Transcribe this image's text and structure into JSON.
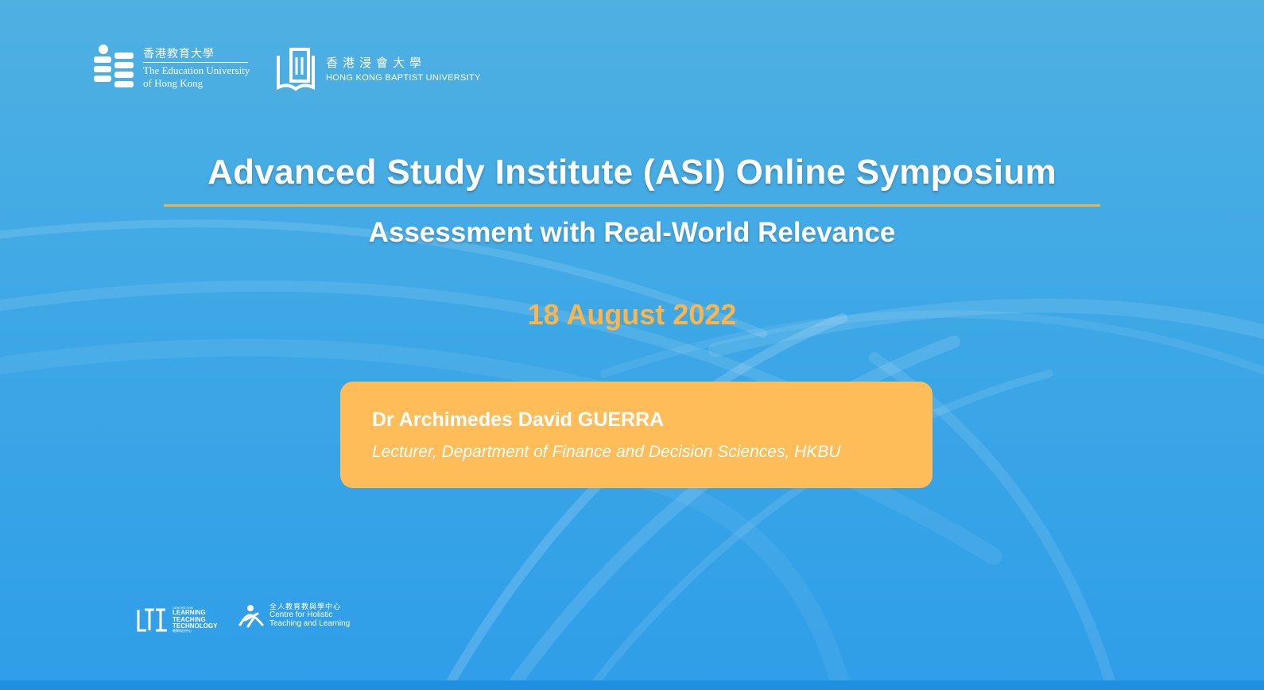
{
  "logos": {
    "eduhk": {
      "cn": "香港教育大學",
      "en_line1": "The Education University",
      "en_line2": "of Hong Kong"
    },
    "hkbu": {
      "cn": "香港浸會大學",
      "en": "HONG KONG BAPTIST UNIVERSITY"
    },
    "lttc": {
      "tiny": "CENTRE FOR",
      "line1": "LEARNING",
      "line2": "TEACHING",
      "line3": "TECHNOLOGY",
      "cn": "教學科技中心"
    },
    "chtl": {
      "cn": "全人教育教與學中心",
      "en_line1": "Centre for Holistic",
      "en_line2": "Teaching and Learning"
    }
  },
  "slide": {
    "title": "Advanced Study Institute (ASI) Online Symposium",
    "subtitle": "Assessment with Real-World Relevance",
    "date": "18 August 2022"
  },
  "speaker": {
    "name": "Dr Archimedes David GUERRA",
    "role": "Lecturer, Department of Finance and Decision Sciences, HKBU"
  },
  "colors": {
    "background": "#3ea8e6",
    "accent_orange": "#fbb54d",
    "card": "#ffbd5a",
    "rule": "#f2b247"
  }
}
